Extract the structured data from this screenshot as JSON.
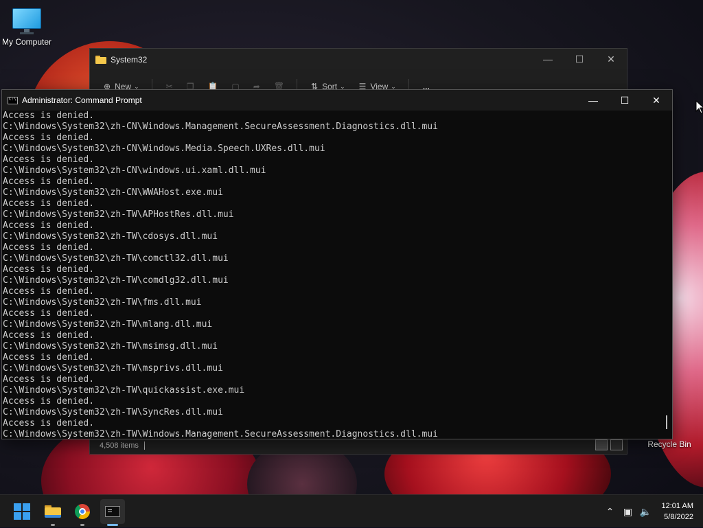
{
  "desktop": {
    "icons": [
      {
        "label": "My Computer"
      },
      {
        "label": "Recycle Bin"
      }
    ]
  },
  "explorer": {
    "title": "System32",
    "toolbar": {
      "new_label": "New",
      "sort_label": "Sort",
      "view_label": "View",
      "more_label": "..."
    },
    "status": {
      "item_count": "4,508 items"
    }
  },
  "cmd": {
    "title": "Administrator: Command Prompt",
    "lines": [
      "Access is denied.",
      "C:\\Windows\\System32\\zh-CN\\Windows.Management.SecureAssessment.Diagnostics.dll.mui",
      "Access is denied.",
      "C:\\Windows\\System32\\zh-CN\\Windows.Media.Speech.UXRes.dll.mui",
      "Access is denied.",
      "C:\\Windows\\System32\\zh-CN\\windows.ui.xaml.dll.mui",
      "Access is denied.",
      "C:\\Windows\\System32\\zh-CN\\WWAHost.exe.mui",
      "Access is denied.",
      "C:\\Windows\\System32\\zh-TW\\APHostRes.dll.mui",
      "Access is denied.",
      "C:\\Windows\\System32\\zh-TW\\cdosys.dll.mui",
      "Access is denied.",
      "C:\\Windows\\System32\\zh-TW\\comctl32.dll.mui",
      "Access is denied.",
      "C:\\Windows\\System32\\zh-TW\\comdlg32.dll.mui",
      "Access is denied.",
      "C:\\Windows\\System32\\zh-TW\\fms.dll.mui",
      "Access is denied.",
      "C:\\Windows\\System32\\zh-TW\\mlang.dll.mui",
      "Access is denied.",
      "C:\\Windows\\System32\\zh-TW\\msimsg.dll.mui",
      "Access is denied.",
      "C:\\Windows\\System32\\zh-TW\\msprivs.dll.mui",
      "Access is denied.",
      "C:\\Windows\\System32\\zh-TW\\quickassist.exe.mui",
      "Access is denied.",
      "C:\\Windows\\System32\\zh-TW\\SyncRes.dll.mui",
      "Access is denied.",
      "C:\\Windows\\System32\\zh-TW\\Windows.Management.SecureAssessment.Diagnostics.dll.mui"
    ]
  },
  "taskbar": {
    "apps": [
      {
        "name": "start-button",
        "icon": "windows-logo-icon"
      },
      {
        "name": "file-explorer",
        "icon": "folder-icon"
      },
      {
        "name": "chrome",
        "icon": "chrome-icon"
      },
      {
        "name": "command-prompt",
        "icon": "terminal-icon",
        "active": true
      }
    ],
    "tray": {
      "time": "12:01 AM",
      "date": "5/8/2022"
    }
  },
  "colors": {
    "console_bg": "#0c0c0c",
    "console_text": "#cccccc",
    "taskbar_bg": "#1c1c1c",
    "accent": "#3aa0f0"
  }
}
